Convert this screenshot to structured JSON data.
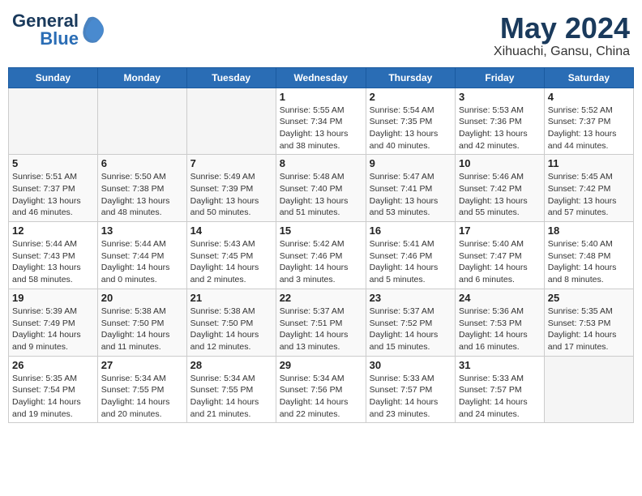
{
  "header": {
    "logo_line1": "General",
    "logo_line2": "Blue",
    "month_year": "May 2024",
    "location": "Xihuachi, Gansu, China"
  },
  "days_of_week": [
    "Sunday",
    "Monday",
    "Tuesday",
    "Wednesday",
    "Thursday",
    "Friday",
    "Saturday"
  ],
  "weeks": [
    [
      {
        "day": "",
        "info": ""
      },
      {
        "day": "",
        "info": ""
      },
      {
        "day": "",
        "info": ""
      },
      {
        "day": "1",
        "info": "Sunrise: 5:55 AM\nSunset: 7:34 PM\nDaylight: 13 hours\nand 38 minutes."
      },
      {
        "day": "2",
        "info": "Sunrise: 5:54 AM\nSunset: 7:35 PM\nDaylight: 13 hours\nand 40 minutes."
      },
      {
        "day": "3",
        "info": "Sunrise: 5:53 AM\nSunset: 7:36 PM\nDaylight: 13 hours\nand 42 minutes."
      },
      {
        "day": "4",
        "info": "Sunrise: 5:52 AM\nSunset: 7:37 PM\nDaylight: 13 hours\nand 44 minutes."
      }
    ],
    [
      {
        "day": "5",
        "info": "Sunrise: 5:51 AM\nSunset: 7:37 PM\nDaylight: 13 hours\nand 46 minutes."
      },
      {
        "day": "6",
        "info": "Sunrise: 5:50 AM\nSunset: 7:38 PM\nDaylight: 13 hours\nand 48 minutes."
      },
      {
        "day": "7",
        "info": "Sunrise: 5:49 AM\nSunset: 7:39 PM\nDaylight: 13 hours\nand 50 minutes."
      },
      {
        "day": "8",
        "info": "Sunrise: 5:48 AM\nSunset: 7:40 PM\nDaylight: 13 hours\nand 51 minutes."
      },
      {
        "day": "9",
        "info": "Sunrise: 5:47 AM\nSunset: 7:41 PM\nDaylight: 13 hours\nand 53 minutes."
      },
      {
        "day": "10",
        "info": "Sunrise: 5:46 AM\nSunset: 7:42 PM\nDaylight: 13 hours\nand 55 minutes."
      },
      {
        "day": "11",
        "info": "Sunrise: 5:45 AM\nSunset: 7:42 PM\nDaylight: 13 hours\nand 57 minutes."
      }
    ],
    [
      {
        "day": "12",
        "info": "Sunrise: 5:44 AM\nSunset: 7:43 PM\nDaylight: 13 hours\nand 58 minutes."
      },
      {
        "day": "13",
        "info": "Sunrise: 5:44 AM\nSunset: 7:44 PM\nDaylight: 14 hours\nand 0 minutes."
      },
      {
        "day": "14",
        "info": "Sunrise: 5:43 AM\nSunset: 7:45 PM\nDaylight: 14 hours\nand 2 minutes."
      },
      {
        "day": "15",
        "info": "Sunrise: 5:42 AM\nSunset: 7:46 PM\nDaylight: 14 hours\nand 3 minutes."
      },
      {
        "day": "16",
        "info": "Sunrise: 5:41 AM\nSunset: 7:46 PM\nDaylight: 14 hours\nand 5 minutes."
      },
      {
        "day": "17",
        "info": "Sunrise: 5:40 AM\nSunset: 7:47 PM\nDaylight: 14 hours\nand 6 minutes."
      },
      {
        "day": "18",
        "info": "Sunrise: 5:40 AM\nSunset: 7:48 PM\nDaylight: 14 hours\nand 8 minutes."
      }
    ],
    [
      {
        "day": "19",
        "info": "Sunrise: 5:39 AM\nSunset: 7:49 PM\nDaylight: 14 hours\nand 9 minutes."
      },
      {
        "day": "20",
        "info": "Sunrise: 5:38 AM\nSunset: 7:50 PM\nDaylight: 14 hours\nand 11 minutes."
      },
      {
        "day": "21",
        "info": "Sunrise: 5:38 AM\nSunset: 7:50 PM\nDaylight: 14 hours\nand 12 minutes."
      },
      {
        "day": "22",
        "info": "Sunrise: 5:37 AM\nSunset: 7:51 PM\nDaylight: 14 hours\nand 13 minutes."
      },
      {
        "day": "23",
        "info": "Sunrise: 5:37 AM\nSunset: 7:52 PM\nDaylight: 14 hours\nand 15 minutes."
      },
      {
        "day": "24",
        "info": "Sunrise: 5:36 AM\nSunset: 7:53 PM\nDaylight: 14 hours\nand 16 minutes."
      },
      {
        "day": "25",
        "info": "Sunrise: 5:35 AM\nSunset: 7:53 PM\nDaylight: 14 hours\nand 17 minutes."
      }
    ],
    [
      {
        "day": "26",
        "info": "Sunrise: 5:35 AM\nSunset: 7:54 PM\nDaylight: 14 hours\nand 19 minutes."
      },
      {
        "day": "27",
        "info": "Sunrise: 5:34 AM\nSunset: 7:55 PM\nDaylight: 14 hours\nand 20 minutes."
      },
      {
        "day": "28",
        "info": "Sunrise: 5:34 AM\nSunset: 7:55 PM\nDaylight: 14 hours\nand 21 minutes."
      },
      {
        "day": "29",
        "info": "Sunrise: 5:34 AM\nSunset: 7:56 PM\nDaylight: 14 hours\nand 22 minutes."
      },
      {
        "day": "30",
        "info": "Sunrise: 5:33 AM\nSunset: 7:57 PM\nDaylight: 14 hours\nand 23 minutes."
      },
      {
        "day": "31",
        "info": "Sunrise: 5:33 AM\nSunset: 7:57 PM\nDaylight: 14 hours\nand 24 minutes."
      },
      {
        "day": "",
        "info": ""
      }
    ]
  ]
}
